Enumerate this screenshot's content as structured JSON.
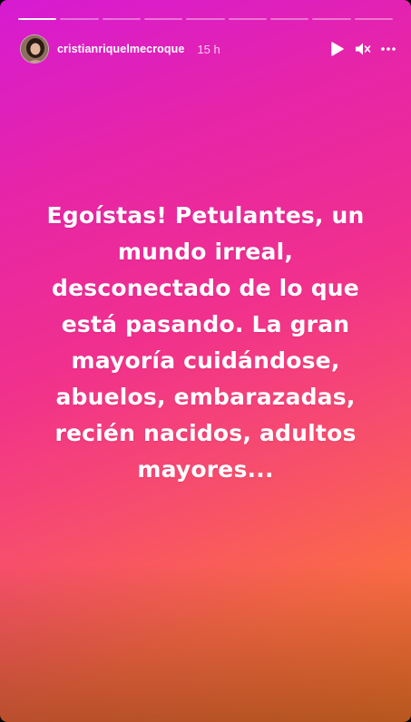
{
  "story": {
    "progress": {
      "total_segments": 9,
      "completed_segments": 1
    },
    "header": {
      "username": "cristianriquelmecroque",
      "time": "15 h"
    },
    "message": "Egoístas! Petulantes, un mundo irreal, desconectado de lo que está pasando. La gran mayoría cuidándose, abuelos, embarazadas, recién nacidos, adultos mayores...",
    "icons": {
      "play": "play-icon",
      "mute": "mute-icon",
      "more": "more-icon"
    },
    "colors": {
      "gradient_top": "#d61bd3",
      "gradient_mid": "#f1308d",
      "gradient_bottom": "#f7782e"
    }
  }
}
